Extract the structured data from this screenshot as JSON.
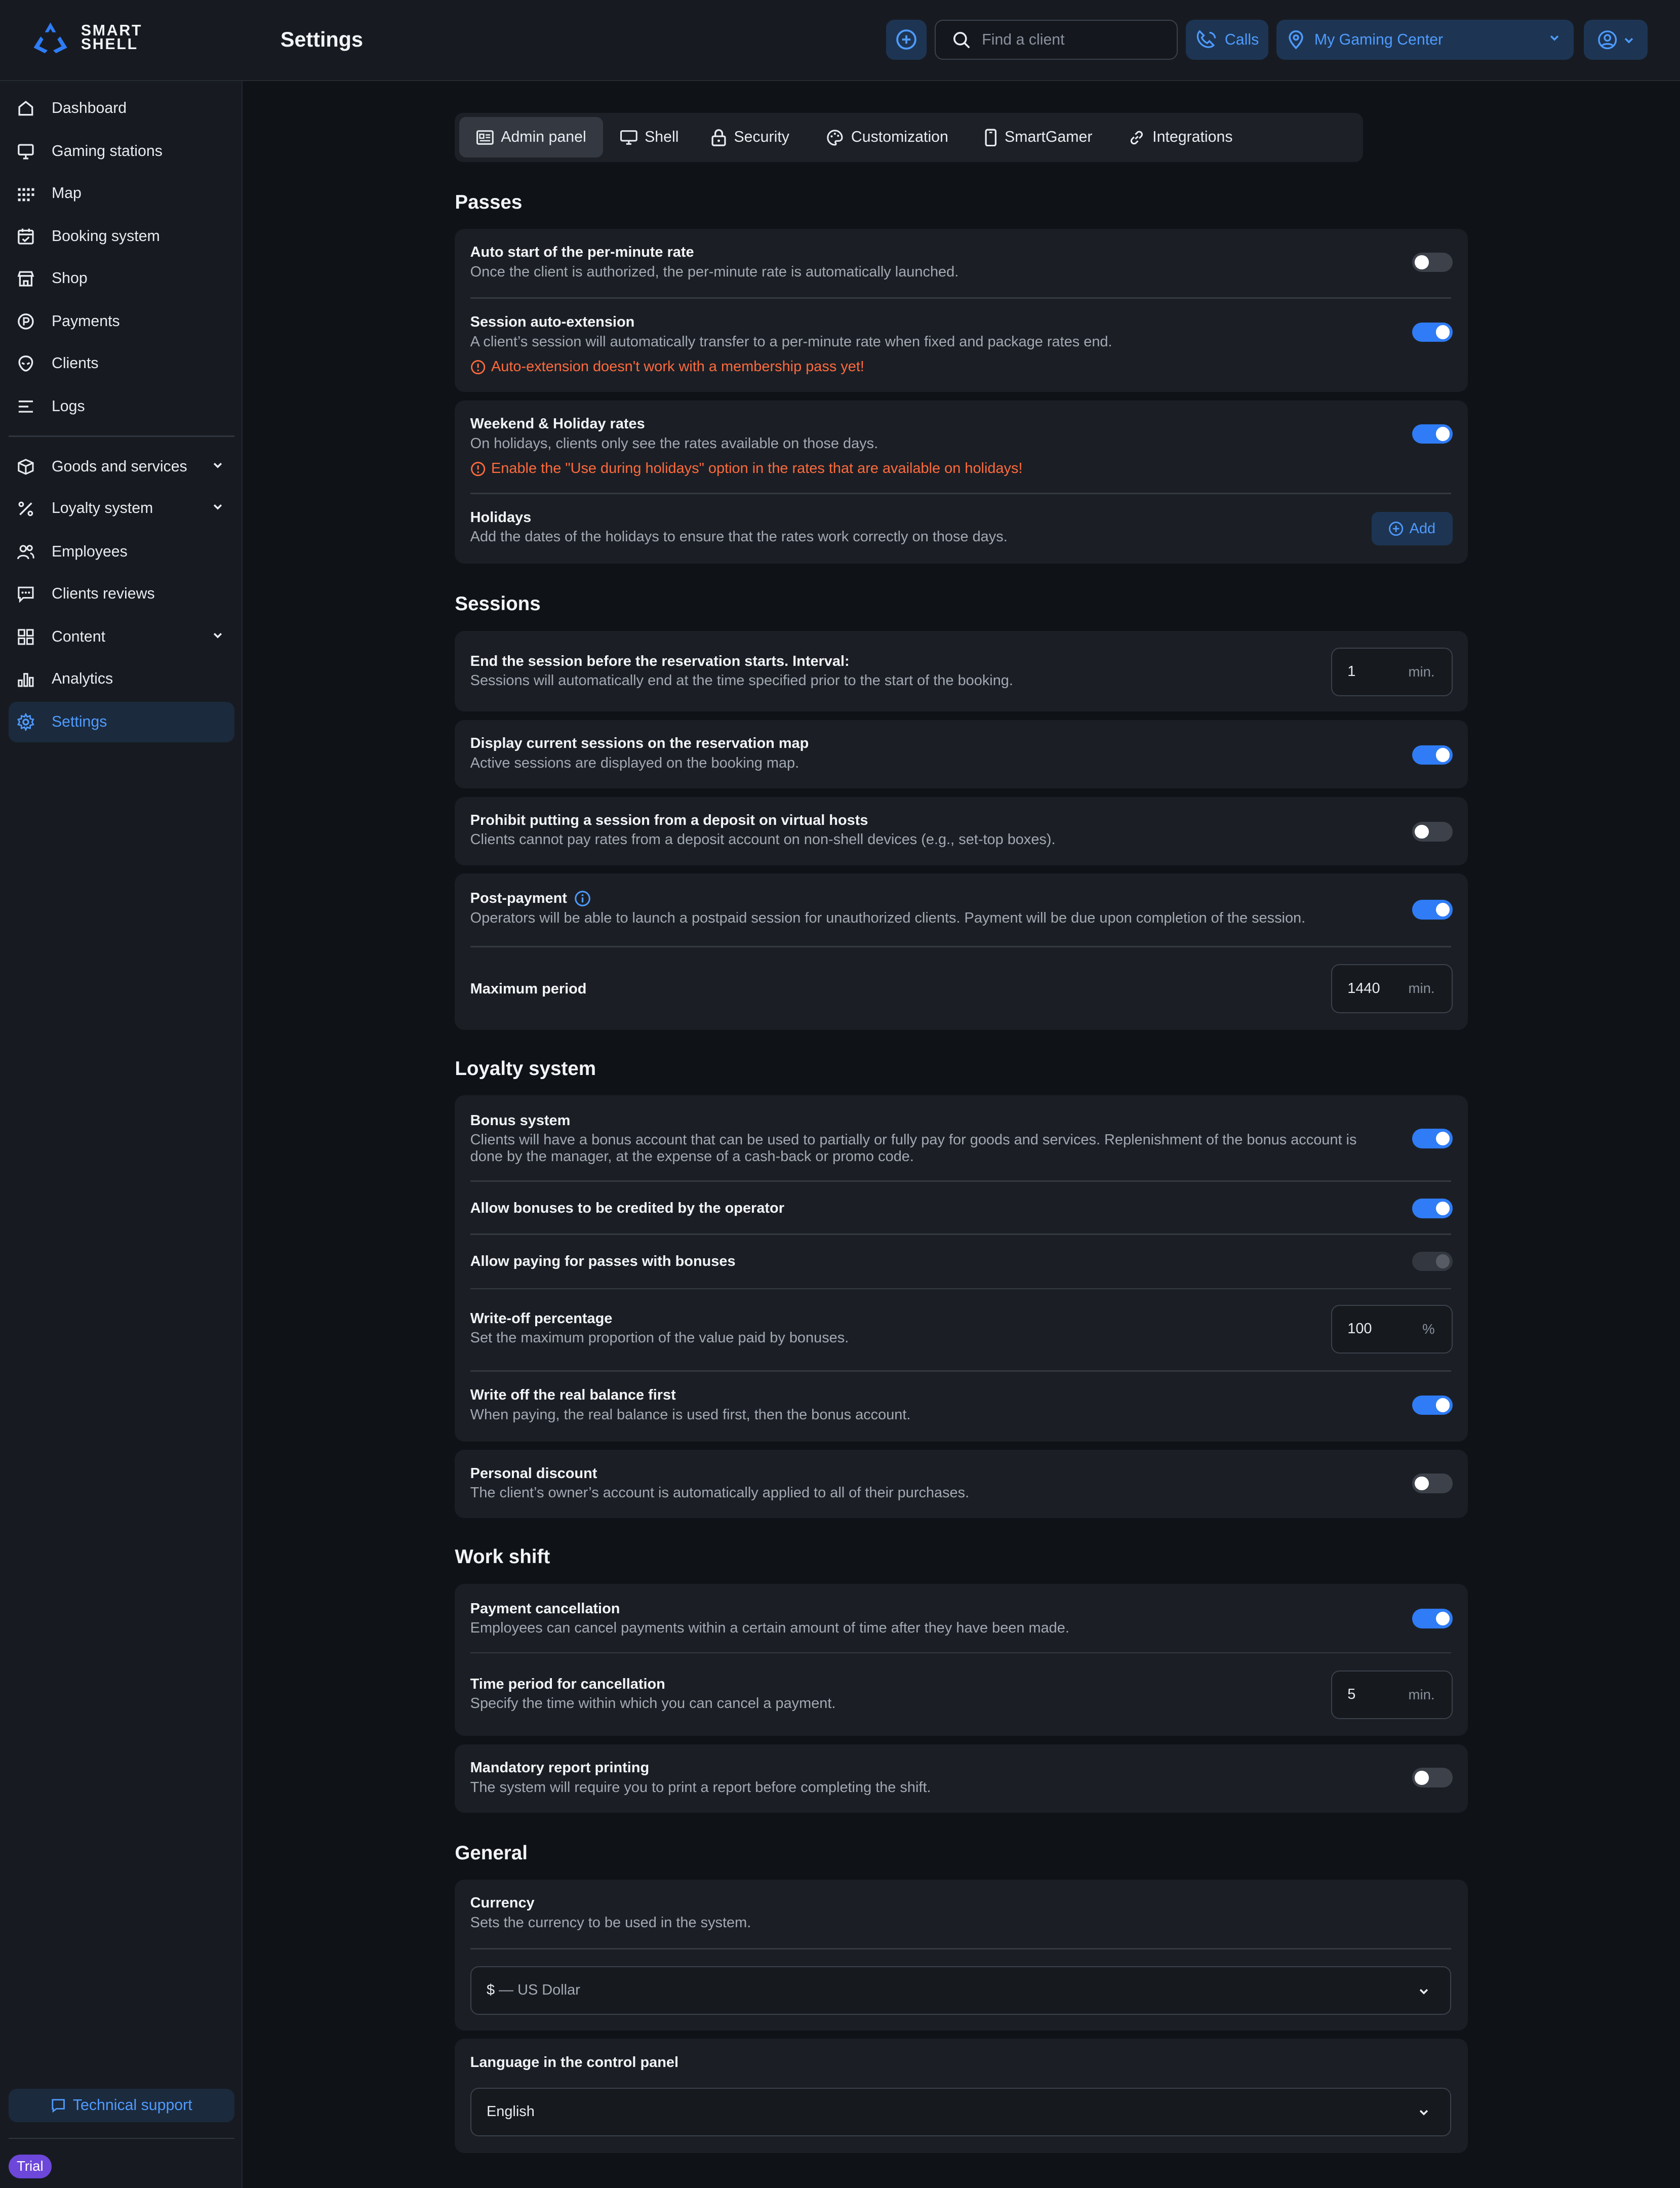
{
  "brand": {
    "line1": "SMART",
    "line2": "SHELL"
  },
  "header": {
    "title": "Settings",
    "search_placeholder": "Find a client",
    "calls_label": "Calls",
    "center_label": "My Gaming Center"
  },
  "sidebar": {
    "items": [
      {
        "label": "Dashboard",
        "icon": "home-icon"
      },
      {
        "label": "Gaming stations",
        "icon": "monitor-icon"
      },
      {
        "label": "Map",
        "icon": "grid-dots-icon"
      },
      {
        "label": "Booking system",
        "icon": "calendar-check-icon"
      },
      {
        "label": "Shop",
        "icon": "store-icon"
      },
      {
        "label": "Payments",
        "icon": "coin-icon"
      },
      {
        "label": "Clients",
        "icon": "alien-head-icon"
      },
      {
        "label": "Logs",
        "icon": "lines-icon"
      },
      {
        "label": "Goods and services",
        "icon": "box-icon"
      },
      {
        "label": "Loyalty system",
        "icon": "percent-icon"
      },
      {
        "label": "Employees",
        "icon": "users-icon"
      },
      {
        "label": "Clients reviews",
        "icon": "chat-icon"
      },
      {
        "label": "Content",
        "icon": "layout-grid-icon"
      },
      {
        "label": "Analytics",
        "icon": "bar-chart-icon"
      },
      {
        "label": "Settings",
        "icon": "gear-icon"
      }
    ],
    "support_label": "Technical support",
    "trial_label": "Trial"
  },
  "tabs": [
    "Admin panel",
    "Shell",
    "Security",
    "Customization",
    "SmartGamer",
    "Integrations"
  ],
  "sections": {
    "passes": {
      "title": "Passes",
      "auto_start": {
        "title": "Auto start of the per-minute rate",
        "desc": "Once the client is authorized, the per-minute rate is automatically launched.",
        "enabled": false
      },
      "auto_extension": {
        "title": "Session auto-extension",
        "desc": "A client’s session will automatically transfer to a per-minute rate when fixed and package rates end.",
        "warning": "Auto-extension doesn't work with a membership pass yet!",
        "enabled": true
      },
      "weekend": {
        "title": "Weekend & Holiday rates",
        "desc": "On holidays, clients only see the rates available on those days.",
        "warning": "Enable the \"Use during holidays\" option in the rates that are available on holidays!",
        "enabled": true
      },
      "holidays": {
        "title": "Holidays",
        "desc": "Add the dates of the holidays to ensure that the rates work correctly on those days.",
        "button": "Add"
      }
    },
    "sessions": {
      "title": "Sessions",
      "end_before": {
        "title": "End the session before the reservation starts. Interval:",
        "desc": "Sessions will automatically end at the time specified prior to the start of the booking.",
        "value": "1",
        "unit": "min."
      },
      "display_current": {
        "title": "Display current sessions on the reservation map",
        "desc": "Active sessions are displayed on the booking map.",
        "enabled": true
      },
      "prohibit_deposit": {
        "title": "Prohibit putting a session from a deposit on virtual hosts",
        "desc": "Clients cannot pay rates from a deposit account on non-shell devices (e.g., set-top boxes).",
        "enabled": false
      },
      "post_payment": {
        "title": "Post-payment",
        "desc": "Operators will be able to launch a postpaid session for unauthorized clients. Payment will be due upon completion of the session.",
        "enabled": true
      },
      "max_period": {
        "title": "Maximum period",
        "value": "1440",
        "unit": "min."
      }
    },
    "loyalty": {
      "title": "Loyalty system",
      "bonus_system": {
        "title": "Bonus system",
        "desc": "Clients will have a bonus account that can be used to partially or fully pay for goods and services. Replenishment of the bonus account is done by the manager, at the expense of a cash-back or promo code.",
        "enabled": true
      },
      "operator_credit": {
        "title": "Allow bonuses to be credited by the operator",
        "enabled": true
      },
      "pay_passes": {
        "title": "Allow paying for passes with bonuses",
        "enabled": false
      },
      "write_off": {
        "title": "Write-off percentage",
        "desc": "Set the maximum proportion of the value paid by bonuses.",
        "value": "100",
        "unit": "%"
      },
      "real_balance": {
        "title": "Write off the real balance first",
        "desc": "When paying, the real balance is used first, then the bonus account.",
        "enabled": true
      },
      "personal_discount": {
        "title": "Personal discount",
        "desc": "The client’s owner’s account is automatically applied to all of their purchases.",
        "enabled": false
      }
    },
    "work_shift": {
      "title": "Work shift",
      "payment_cancel": {
        "title": "Payment cancellation",
        "desc": "Employees can cancel payments within a certain amount of time after they have been made.",
        "enabled": true
      },
      "cancel_period": {
        "title": "Time period for cancellation",
        "desc": "Specify the time within which you can cancel a payment.",
        "value": "5",
        "unit": "min."
      },
      "report_printing": {
        "title": "Mandatory report printing",
        "desc": "The system will require you to print a report before completing the shift.",
        "enabled": false
      }
    },
    "general": {
      "title": "General",
      "currency": {
        "title": "Currency",
        "desc": "Sets the currency to be used in the system.",
        "symbol": "$",
        "name": "— US Dollar"
      },
      "language": {
        "title": "Language in the control panel",
        "value": "English"
      }
    }
  },
  "colors": {
    "accent": "#2f7cf6",
    "accent_text": "#4f9bff",
    "warning": "#ff6a3d",
    "trial": "#6d47d9"
  }
}
